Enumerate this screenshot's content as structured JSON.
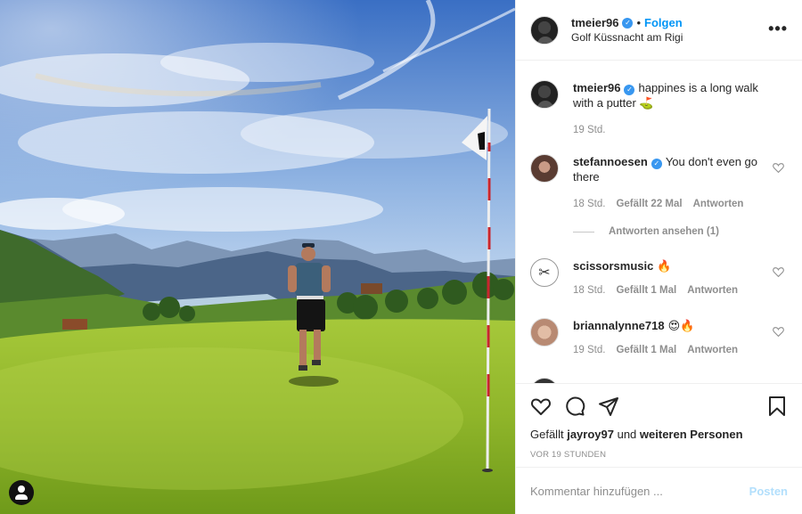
{
  "post": {
    "author": "tmeier96",
    "follow_label": "Folgen",
    "separator": "•",
    "location": "Golf Küssnacht am Rigi",
    "more_label": "•••"
  },
  "caption": {
    "username": "tmeier96",
    "text": "happines is a long walk with a putter ⛳",
    "time": "19 Std."
  },
  "comments": [
    {
      "username": "stefannoesen",
      "verified": true,
      "text": "You don't even go there",
      "time": "18 Std.",
      "likes": "Gefällt 22 Mal",
      "reply": "Antworten",
      "view_replies": "Antworten ansehen (1)"
    },
    {
      "username": "scissorsmusic",
      "text": "🔥",
      "time": "18 Std.",
      "likes": "Gefällt 1 Mal",
      "reply": "Antworten"
    },
    {
      "username": "briannalynne718",
      "text": "😍🔥",
      "time": "19 Std.",
      "likes": "Gefällt 1 Mal",
      "reply": "Antworten"
    }
  ],
  "likes_line": {
    "prefix": "Gefällt",
    "user": "jayroy97",
    "middle": "und",
    "others": "weiteren Personen"
  },
  "timestamp": "VOR 19 STUNDEN",
  "composer": {
    "placeholder": "Kommentar hinzufügen ...",
    "post_label": "Posten"
  },
  "colors": {
    "link_blue": "#0095f6",
    "verified_blue": "#3897f0",
    "muted": "#8e8e8e",
    "post_disabled": "#b2dffc"
  }
}
